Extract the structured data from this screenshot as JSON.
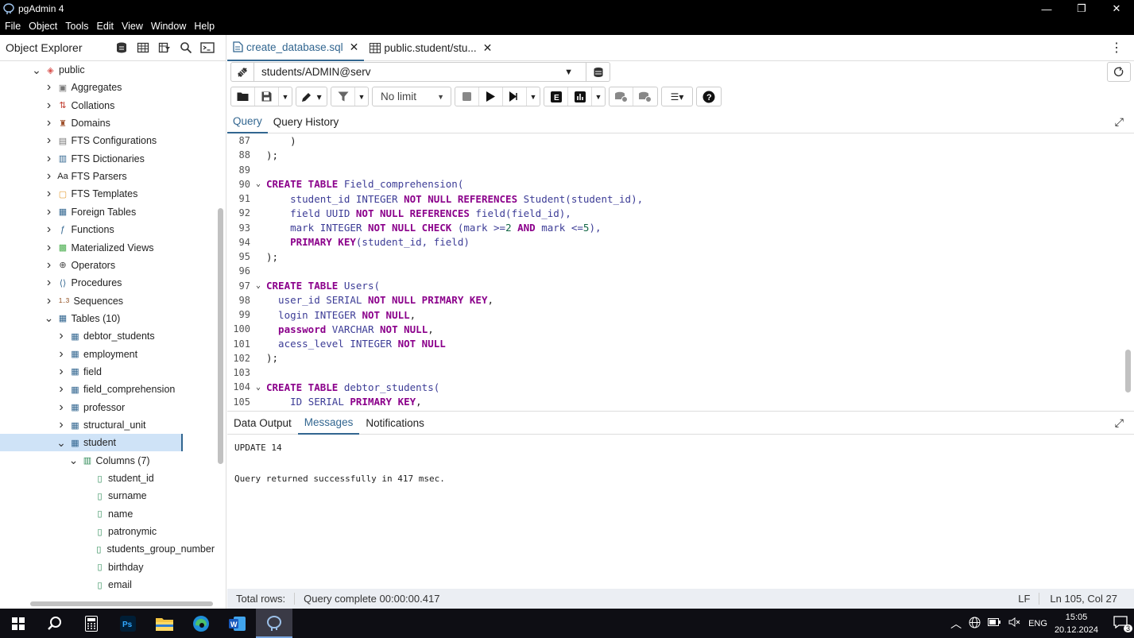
{
  "window": {
    "title": "pgAdmin 4",
    "controls": [
      "—",
      "❐",
      "✕"
    ]
  },
  "menu": [
    "File",
    "Object",
    "Tools",
    "Edit",
    "View",
    "Window",
    "Help"
  ],
  "object_explorer": {
    "title": "Object Explorer",
    "tree": [
      {
        "label": "public",
        "indent": 0,
        "chev": "⌄",
        "icon": "schema-icon"
      },
      {
        "label": "Aggregates",
        "indent": 1,
        "chev": "›",
        "icon": "aggregates-icon"
      },
      {
        "label": "Collations",
        "indent": 1,
        "chev": "›",
        "icon": "collations-icon"
      },
      {
        "label": "Domains",
        "indent": 1,
        "chev": "›",
        "icon": "domains-icon"
      },
      {
        "label": "FTS Configurations",
        "indent": 1,
        "chev": "›",
        "icon": "fts-config-icon"
      },
      {
        "label": "FTS Dictionaries",
        "indent": 1,
        "chev": "›",
        "icon": "fts-dict-icon"
      },
      {
        "label": "FTS Parsers",
        "indent": 1,
        "chev": "›",
        "icon": "fts-parser-icon"
      },
      {
        "label": "FTS Templates",
        "indent": 1,
        "chev": "›",
        "icon": "fts-template-icon"
      },
      {
        "label": "Foreign Tables",
        "indent": 1,
        "chev": "›",
        "icon": "foreign-table-icon"
      },
      {
        "label": "Functions",
        "indent": 1,
        "chev": "›",
        "icon": "function-icon"
      },
      {
        "label": "Materialized Views",
        "indent": 1,
        "chev": "›",
        "icon": "mview-icon"
      },
      {
        "label": "Operators",
        "indent": 1,
        "chev": "›",
        "icon": "operator-icon"
      },
      {
        "label": "Procedures",
        "indent": 1,
        "chev": "›",
        "icon": "procedure-icon"
      },
      {
        "label": "Sequences",
        "indent": 1,
        "chev": "›",
        "icon": "sequence-icon"
      },
      {
        "label": "Tables (10)",
        "indent": 1,
        "chev": "⌄",
        "icon": "tables-icon"
      },
      {
        "label": "debtor_students",
        "indent": 2,
        "chev": "›",
        "icon": "table-icon"
      },
      {
        "label": "employment",
        "indent": 2,
        "chev": "›",
        "icon": "table-icon"
      },
      {
        "label": "field",
        "indent": 2,
        "chev": "›",
        "icon": "table-icon"
      },
      {
        "label": "field_comprehension",
        "indent": 2,
        "chev": "›",
        "icon": "table-icon"
      },
      {
        "label": "professor",
        "indent": 2,
        "chev": "›",
        "icon": "table-icon"
      },
      {
        "label": "structural_unit",
        "indent": 2,
        "chev": "›",
        "icon": "table-icon"
      },
      {
        "label": "student",
        "indent": 2,
        "chev": "⌄",
        "icon": "table-icon",
        "selected": true
      },
      {
        "label": "Columns (7)",
        "indent": 3,
        "chev": "⌄",
        "icon": "columns-icon"
      },
      {
        "label": "student_id",
        "indent": 4,
        "chev": "",
        "icon": "column-icon"
      },
      {
        "label": "surname",
        "indent": 4,
        "chev": "",
        "icon": "column-icon"
      },
      {
        "label": "name",
        "indent": 4,
        "chev": "",
        "icon": "column-icon"
      },
      {
        "label": "patronymic",
        "indent": 4,
        "chev": "",
        "icon": "column-icon"
      },
      {
        "label": "students_group_number",
        "indent": 4,
        "chev": "",
        "icon": "column-icon"
      },
      {
        "label": "birthday",
        "indent": 4,
        "chev": "",
        "icon": "column-icon"
      },
      {
        "label": "email",
        "indent": 4,
        "chev": "",
        "icon": "column-icon"
      }
    ]
  },
  "tabs": [
    {
      "label": "create_database.sql",
      "active": true,
      "icon": "sql-file-icon"
    },
    {
      "label": "public.student/stu...",
      "active": false,
      "icon": "table-icon"
    }
  ],
  "connection": {
    "value": "students/ADMIN@serv"
  },
  "toolbar": {
    "limit": "No limit"
  },
  "query_tabs": [
    "Query",
    "Query History"
  ],
  "editor_lines": [
    {
      "n": "87",
      "fold": "",
      "code": [
        [
          "    )",
          ""
        ]
      ]
    },
    {
      "n": "88",
      "fold": "",
      "code": [
        [
          ");",
          ""
        ]
      ]
    },
    {
      "n": "89",
      "fold": "",
      "code": [
        [
          "",
          ""
        ]
      ]
    },
    {
      "n": "90",
      "fold": "⌄",
      "code": [
        [
          "CREATE TABLE",
          "kw"
        ],
        [
          " Field_comprehension(",
          "ty"
        ]
      ]
    },
    {
      "n": "91",
      "fold": "",
      "code": [
        [
          "    student_id ",
          "ty"
        ],
        [
          "INTEGER ",
          "ty"
        ],
        [
          "NOT NULL REFERENCES ",
          "kw"
        ],
        [
          "Student(student_id),",
          "ty"
        ]
      ]
    },
    {
      "n": "92",
      "fold": "",
      "code": [
        [
          "    field ",
          "ty"
        ],
        [
          "UUID ",
          "ty"
        ],
        [
          "NOT NULL REFERENCES ",
          "kw"
        ],
        [
          "field(field_id),",
          "ty"
        ]
      ]
    },
    {
      "n": "93",
      "fold": "",
      "code": [
        [
          "    mark ",
          "ty"
        ],
        [
          "INTEGER ",
          "ty"
        ],
        [
          "NOT NULL CHECK ",
          "kw"
        ],
        [
          "(mark >=",
          "ty"
        ],
        [
          "2",
          "num"
        ],
        [
          " AND ",
          "kw"
        ],
        [
          "mark <=",
          "ty"
        ],
        [
          "5",
          "num"
        ],
        [
          "),",
          "ty"
        ]
      ]
    },
    {
      "n": "94",
      "fold": "",
      "code": [
        [
          "    PRIMARY KEY",
          "kw"
        ],
        [
          "(student_id, field)",
          "ty"
        ]
      ]
    },
    {
      "n": "95",
      "fold": "",
      "code": [
        [
          ");",
          ""
        ]
      ]
    },
    {
      "n": "96",
      "fold": "",
      "code": [
        [
          "",
          ""
        ]
      ]
    },
    {
      "n": "97",
      "fold": "⌄",
      "code": [
        [
          "CREATE TABLE",
          "kw"
        ],
        [
          " Users(",
          "ty"
        ]
      ]
    },
    {
      "n": "98",
      "fold": "",
      "code": [
        [
          "  user_id ",
          "ty"
        ],
        [
          "SERIAL ",
          "ty"
        ],
        [
          "NOT NULL PRIMARY KEY",
          "kw"
        ],
        [
          ",",
          ""
        ]
      ]
    },
    {
      "n": "99",
      "fold": "",
      "code": [
        [
          "  login ",
          "ty"
        ],
        [
          "INTEGER ",
          "ty"
        ],
        [
          "NOT NULL",
          "kw"
        ],
        [
          ",",
          ""
        ]
      ]
    },
    {
      "n": "100",
      "fold": "",
      "code": [
        [
          "  password ",
          "kw"
        ],
        [
          "VARCHAR ",
          "ty"
        ],
        [
          "NOT NULL",
          "kw"
        ],
        [
          ",",
          ""
        ]
      ]
    },
    {
      "n": "101",
      "fold": "",
      "code": [
        [
          "  acess_level ",
          "ty"
        ],
        [
          "INTEGER ",
          "ty"
        ],
        [
          "NOT NULL",
          "kw"
        ]
      ]
    },
    {
      "n": "102",
      "fold": "",
      "code": [
        [
          ");",
          ""
        ]
      ]
    },
    {
      "n": "103",
      "fold": "",
      "code": [
        [
          "",
          ""
        ]
      ]
    },
    {
      "n": "104",
      "fold": "⌄",
      "code": [
        [
          "CREATE TABLE",
          "kw"
        ],
        [
          " debtor_students(",
          "ty"
        ]
      ]
    },
    {
      "n": "105",
      "fold": "",
      "code": [
        [
          "    ID ",
          "ty"
        ],
        [
          "SERIAL ",
          "ty"
        ],
        [
          "PRIMARY KEY",
          "kw"
        ],
        [
          ",",
          ""
        ]
      ]
    }
  ],
  "output_tabs": [
    "Data Output",
    "Messages",
    "Notifications"
  ],
  "messages": [
    "UPDATE 14",
    "Query returned successfully in 417 msec."
  ],
  "status": {
    "total_rows": "Total rows:",
    "query_complete": "Query complete 00:00:00.417",
    "eol": "LF",
    "position": "Ln 105, Col 27"
  },
  "taskbar": {
    "lang": "ENG",
    "time": "15:05",
    "date": "20.12.2024",
    "notif_count": "3"
  },
  "colors": {
    "accent": "#326690",
    "selected": "#cfe3f7"
  }
}
